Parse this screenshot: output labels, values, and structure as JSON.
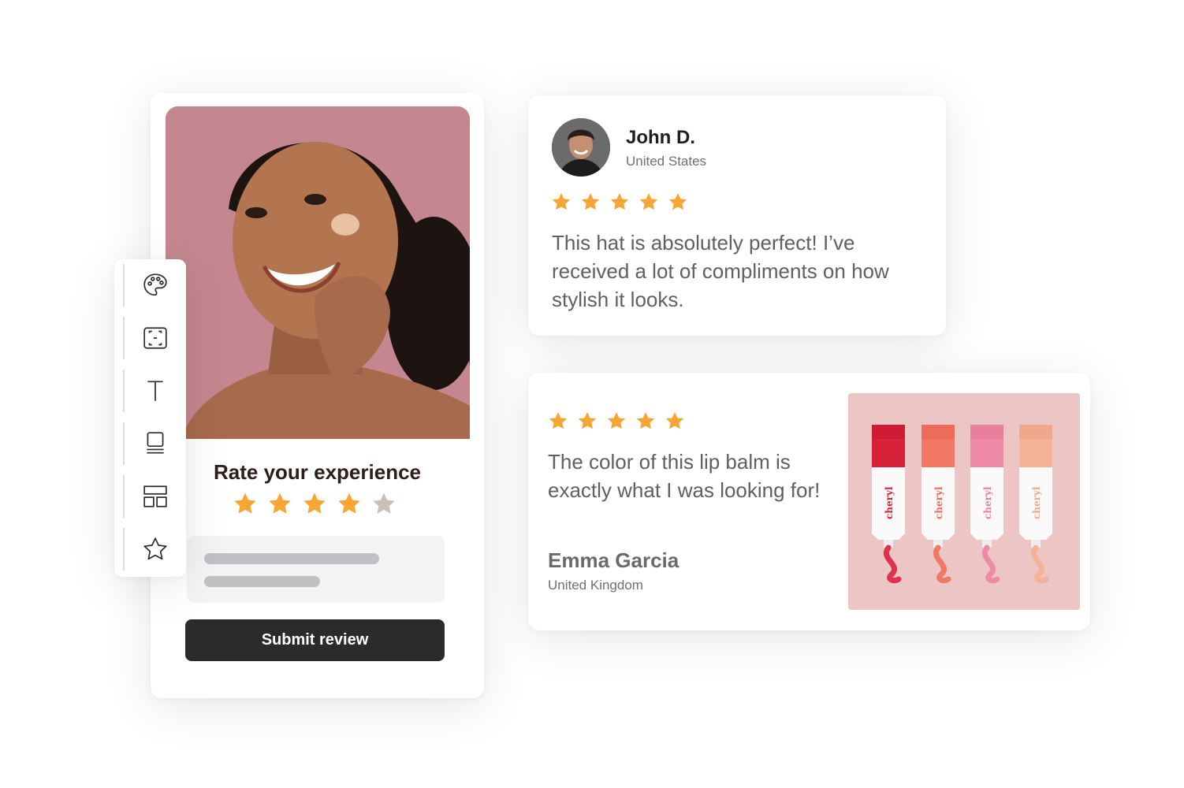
{
  "toolbar": {
    "items": [
      {
        "icon": "palette-icon"
      },
      {
        "icon": "frame-icon"
      },
      {
        "icon": "text-icon"
      },
      {
        "icon": "card-layout-icon"
      },
      {
        "icon": "grid-layout-icon"
      },
      {
        "icon": "star-outline-icon"
      }
    ]
  },
  "form": {
    "title": "Rate your experience",
    "rating": 4,
    "max_rating": 5,
    "submit_label": "Submit review"
  },
  "reviews": [
    {
      "name": "John D.",
      "country": "United States",
      "rating": 5,
      "text": "This hat is absolutely perfect!  I’ve received a lot of compliments on how stylish it looks."
    },
    {
      "name": "Emma Garcia",
      "country": "United Kingdom",
      "rating": 5,
      "text": "The color of this lip balm is exactly what I was looking for!",
      "product_brand": "cheryl"
    }
  ],
  "colors": {
    "star_filled": "#f7a534",
    "star_empty": "#cbbfb8",
    "button_bg": "#2b2b2d",
    "photo_bg": "#c4878f",
    "product_bg": "#ecc6c4"
  }
}
